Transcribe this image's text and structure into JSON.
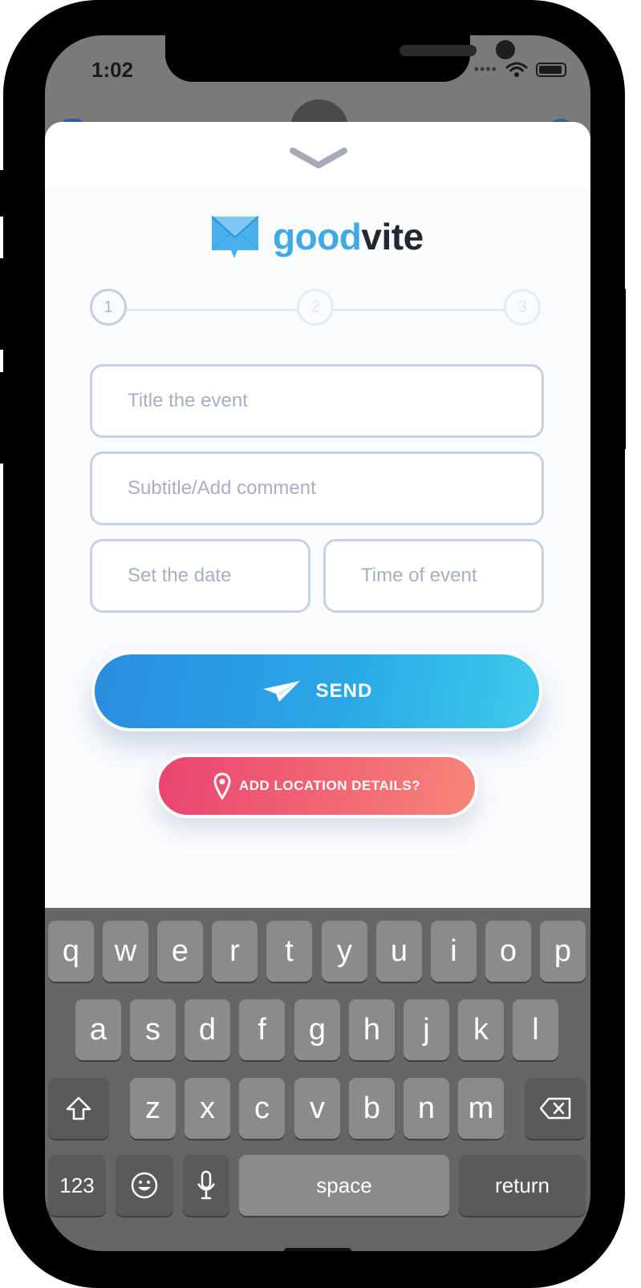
{
  "status_bar": {
    "time": "1:02"
  },
  "brand": {
    "part1": "good",
    "part2": "vite",
    "accent": "#3fa9e9"
  },
  "stepper": {
    "steps": [
      "1",
      "2",
      "3"
    ],
    "current": 1
  },
  "form": {
    "title_placeholder": "Title the event",
    "subtitle_placeholder": "Subtitle/Add comment",
    "date_placeholder": "Set the date",
    "time_placeholder": "Time of event"
  },
  "actions": {
    "send_label": "SEND",
    "location_label": "ADD LOCATION DETAILS?"
  },
  "colors": {
    "send_start": "#2a8de0",
    "send_end": "#3fcbec",
    "location_start": "#ea4470",
    "location_end": "#f8857a"
  },
  "keyboard": {
    "row1": [
      "q",
      "w",
      "e",
      "r",
      "t",
      "y",
      "u",
      "i",
      "o",
      "p"
    ],
    "row2": [
      "a",
      "s",
      "d",
      "f",
      "g",
      "h",
      "j",
      "k",
      "l"
    ],
    "row3": [
      "z",
      "x",
      "c",
      "v",
      "b",
      "n",
      "m"
    ],
    "numbers_label": "123",
    "space_label": "space",
    "return_label": "return"
  }
}
